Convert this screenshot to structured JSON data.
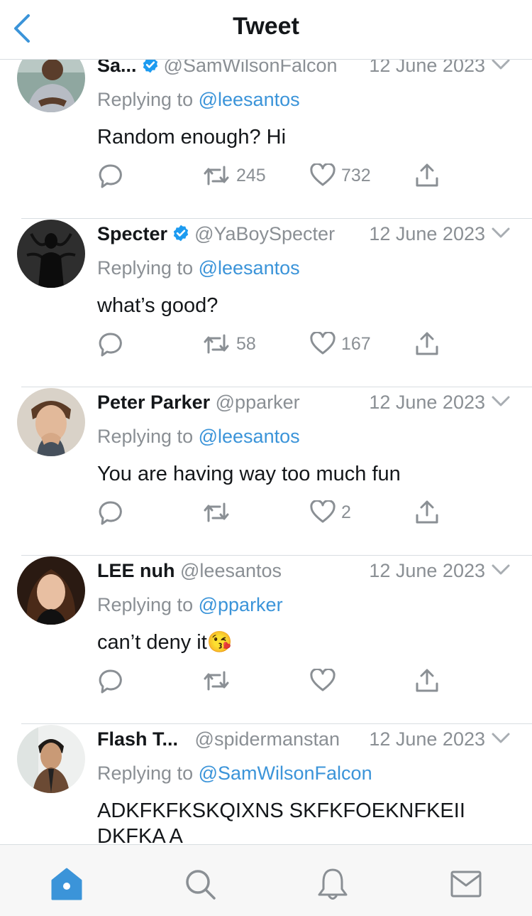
{
  "header": {
    "title": "Tweet",
    "back_icon": "chevron-left-icon"
  },
  "colors": {
    "accent": "#3b94d9",
    "verified": "#1d9bf0",
    "secondary_text": "#8a8f94"
  },
  "tweets": [
    {
      "name": "Sa...",
      "verified": true,
      "handle": "@SamWilsonFalcon",
      "date": "12 June 2023",
      "reply_prefix": "Replying to",
      "reply_to": "@leesantos",
      "text": "Random enough? Hi",
      "retweets": "245",
      "likes": "732"
    },
    {
      "name": "Specter",
      "verified": true,
      "handle": "@YaBoySpecter",
      "date": "12 June 2023",
      "reply_prefix": "Replying to",
      "reply_to": "@leesantos",
      "text": "what’s good?",
      "retweets": "58",
      "likes": "167"
    },
    {
      "name": "Peter Parker",
      "verified": false,
      "handle": "@pparker",
      "date": "12 June 2023",
      "reply_prefix": "Replying to",
      "reply_to": "@leesantos",
      "text": "You are having way too much fun",
      "retweets": "",
      "likes": "2"
    },
    {
      "name": "LEE nuh",
      "verified": false,
      "handle": "@leesantos",
      "date": "12 June 2023",
      "reply_prefix": "Replying to",
      "reply_to": "@pparker",
      "text": "can’t deny it😘",
      "retweets": "",
      "likes": ""
    },
    {
      "name": "Flash T...",
      "verified": false,
      "handle": "@spidermanstan",
      "date": "12 June 2023",
      "reply_prefix": "Replying to",
      "reply_to": "@SamWilsonFalcon",
      "text": "ADKFKFKSKQIXNS SKFKFOEKNFKEII DKFKA A",
      "retweets": "",
      "likes": ""
    }
  ],
  "tabbar": {
    "items": [
      "home-icon",
      "search-icon",
      "notifications-icon",
      "messages-icon"
    ],
    "active": "home-icon"
  }
}
